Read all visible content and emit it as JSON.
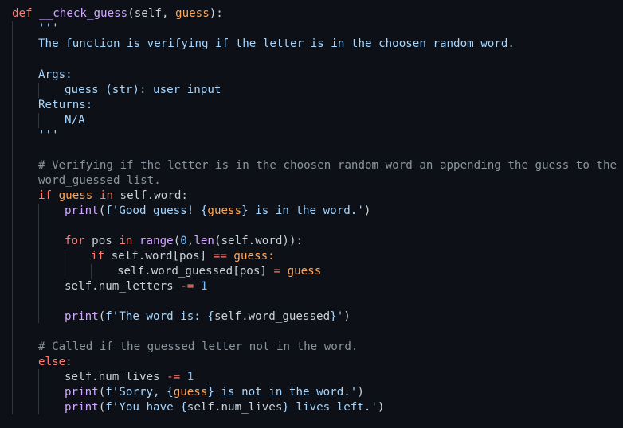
{
  "code": {
    "def_kw": "def",
    "func_name": "__check_guess",
    "sig_rest_1": "(",
    "self_param": "self",
    "sig_comma": ", ",
    "guess_param": "guess",
    "sig_end": "):",
    "doc_open": "'''",
    "doc_line1": "The function is verifying if the letter is in the choosen random word.",
    "doc_args": "Args:",
    "doc_arg_guess": "guess (str): user input",
    "doc_returns": "Returns:",
    "doc_na": "N/A",
    "doc_close": "'''",
    "comment1_a": "# Verifying if the letter is in the choosen random word an appending the guess to the",
    "comment1_b": "word_guessed list.",
    "if_kw": "if",
    "if_guess": "guess",
    "if_in": "in",
    "if_selfword": "self.word:",
    "print1_fn": "print",
    "print1_open": "(",
    "print1_f": "f'Good guess! ",
    "print1_brace_open": "{",
    "print1_var": "guess",
    "print1_brace_close": "}",
    "print1_rest": " is in the word.'",
    "print1_close": ")",
    "for_kw": "for",
    "for_pos": "pos",
    "for_in": "in",
    "for_range": "range",
    "for_open": "(",
    "for_zero": "0",
    "for_comma": ",",
    "for_len": "len",
    "for_args": "(self.word)",
    "for_close": "):",
    "if2_kw": "if",
    "if2_selfword": "self.word[pos]",
    "if2_eq": "==",
    "if2_guess": "guess:",
    "assign_lhs": "self.word_guessed[pos]",
    "assign_eq": "=",
    "assign_rhs": "guess",
    "numletters_lhs": "self.num_letters",
    "numletters_op": "-=",
    "numletters_val": "1",
    "print2_fn": "print",
    "print2_open": "(",
    "print2_f": "f'The word is: ",
    "print2_brace_open": "{",
    "print2_var": "self.word_guessed",
    "print2_brace_close": "}",
    "print2_rest": "'",
    "print2_close": ")",
    "comment2": "# Called if the guessed letter not in the word.",
    "else_kw": "else",
    "else_colon": ":",
    "numlives_lhs": "self.num_lives",
    "numlives_op": "-=",
    "numlives_val": "1",
    "print3_fn": "print",
    "print3_open": "(",
    "print3_f": "f'Sorry, ",
    "print3_brace_open": "{",
    "print3_var": "guess",
    "print3_brace_close": "}",
    "print3_rest": " is not in the word.'",
    "print3_close": ")",
    "print4_fn": "print",
    "print4_open": "(",
    "print4_f": "f'You have ",
    "print4_brace_open": "{",
    "print4_var": "self.num_lives",
    "print4_brace_close": "}",
    "print4_rest": " lives left.'",
    "print4_close": ")"
  }
}
